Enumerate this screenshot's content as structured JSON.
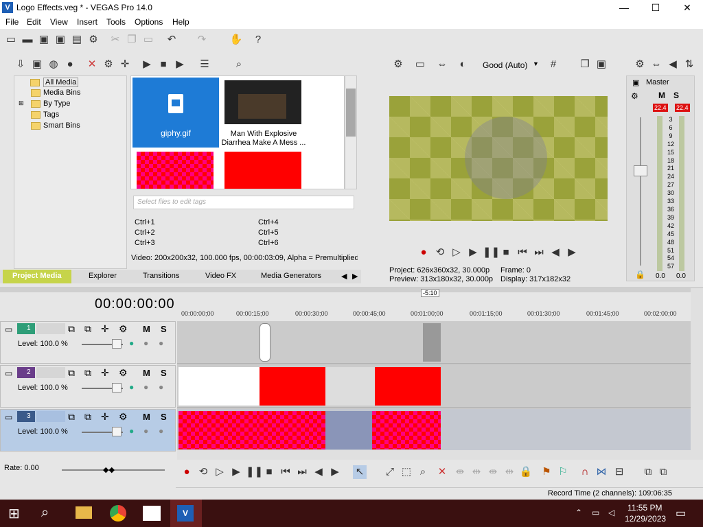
{
  "window": {
    "title": "Logo Effects.veg * - VEGAS Pro 14.0",
    "minimize": "—",
    "maximize": "☐",
    "close": "✕"
  },
  "menu": [
    "File",
    "Edit",
    "View",
    "Insert",
    "Tools",
    "Options",
    "Help"
  ],
  "explorer": {
    "tree": [
      "All Media",
      "Media Bins",
      "By Type",
      "Tags",
      "Smart Bins"
    ],
    "media": [
      {
        "label": "giphy.gif"
      },
      {
        "label": "Man With Explosive Diarrhea Make A Mess ..."
      }
    ],
    "tag_placeholder": "Select files to edit tags",
    "shortcuts": [
      "Ctrl+1",
      "Ctrl+2",
      "Ctrl+3",
      "Ctrl+4",
      "Ctrl+5",
      "Ctrl+6"
    ],
    "info": "Video: 200x200x32, 100.000 fps, 00:00:03:09, Alpha = Premultiplied"
  },
  "tabs": [
    "Project Media",
    "Explorer",
    "Transitions",
    "Video FX",
    "Media Generators"
  ],
  "preview": {
    "quality": "Good (Auto)",
    "project": "Project:  626x360x32, 30.000p",
    "preview_line": "Preview:  313x180x32, 30.000p",
    "frame": "Frame:     0",
    "display": "Display:   317x182x32"
  },
  "mixer": {
    "label": "Master",
    "peak_left": "22.4",
    "peak_right": "22.4",
    "scale": [
      "3",
      "6",
      "9",
      "12",
      "15",
      "18",
      "21",
      "24",
      "27",
      "30",
      "33",
      "36",
      "39",
      "42",
      "45",
      "48",
      "51",
      "54",
      "57"
    ],
    "value_left": "0.0",
    "value_right": "0.0"
  },
  "timeline": {
    "timecode": "00:00:00:00",
    "marker": "-5:10",
    "ticks": [
      "00:00:00;00",
      "00:00:15;00",
      "00:00:30;00",
      "00:00:45;00",
      "00:01:00;00",
      "00:01:15;00",
      "00:01:30;00",
      "00:01:45;00",
      "00:02:00;00"
    ],
    "tracks": [
      {
        "num": "1",
        "level": "Level: 100.0 %",
        "m": "M",
        "s": "S"
      },
      {
        "num": "2",
        "level": "Level: 100.0 %",
        "m": "M",
        "s": "S"
      },
      {
        "num": "3",
        "level": "Level: 100.0 %",
        "m": "M",
        "s": "S"
      }
    ],
    "rate": "Rate: 0.00",
    "record_time": "Record Time (2 channels): 109:06:35"
  },
  "taskbar": {
    "time": "11:55 PM",
    "date": "12/29/2023"
  }
}
